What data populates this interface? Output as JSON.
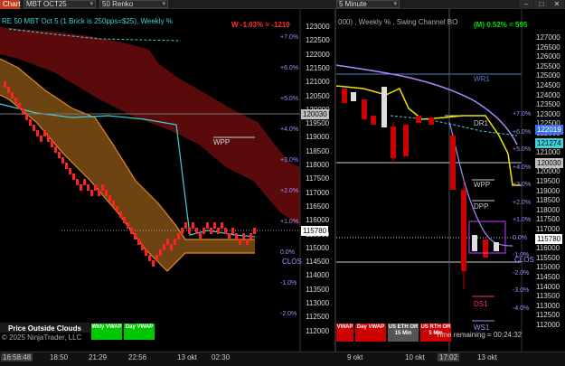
{
  "toolbar": {
    "chart_tab": "Chart",
    "instrument": "MBT OCT25",
    "bar_type": "50 Renko",
    "interval": "5 Minute",
    "win_minimize": "–",
    "win_maximize": "□",
    "win_close": "✕"
  },
  "left": {
    "title": "RE 50 MBT Oct 5 (1 Brick is 250pps=$25), Weekly %",
    "pnl": "W -1.03% = -1210",
    "y_ticks": [
      "123000",
      "122500",
      "122000",
      "121500",
      "121000",
      "120500",
      "120000",
      "119500",
      "119000",
      "118500",
      "118000",
      "117500",
      "117000",
      "116500",
      "116000",
      "115500",
      "115000",
      "114500",
      "114000",
      "113500",
      "113000",
      "112500",
      "112000"
    ],
    "pct_labels": [
      "+7.0%",
      "+6.0%",
      "+5.0%",
      "+4.0%",
      "+3.0%",
      "+2.0%",
      "+1.0%",
      "0.0%",
      "-1.0%",
      "-2.0%"
    ],
    "price_tag_ref": "120030",
    "price_tag_last": "115780",
    "wpp_label": "WPP",
    "clos_label": "CLOS",
    "outside_clouds": "Price Outside Clouds",
    "wkly_vwap": "Wkly VWAP",
    "day_vwap": "Day VWAP",
    "copyright": "© 2025 NinjaTrader, LLC",
    "x_labels": [
      "16:58:48",
      "18:50",
      "21:29",
      "22:56",
      "13 okt",
      "02:30"
    ]
  },
  "right": {
    "title": "000) , Weekly % , Swing Channel BO",
    "pnl": "(M) 0.52% = 595",
    "y_ticks": [
      "127000",
      "126500",
      "126000",
      "125500",
      "125000",
      "124500",
      "124000",
      "123500",
      "123000",
      "122500",
      "122000",
      "121500",
      "121000",
      "120500",
      "120000",
      "119500",
      "119000",
      "118500",
      "118000",
      "117500",
      "117000",
      "116500",
      "116000",
      "115500",
      "115000",
      "114500",
      "114000",
      "113500",
      "113000",
      "112500",
      "112000"
    ],
    "pct_labels": [
      "+7.0%",
      "+6.0%",
      "+5.0%",
      "+4.0%",
      "+3.0%",
      "+2.0%",
      "+1.0%",
      "0.0%",
      "-1.0%",
      "-2.0%",
      "-3.0%",
      "-4.0%"
    ],
    "levels": {
      "wr1": "WR1",
      "dr1": "DR1",
      "wpp": "WPP",
      "dpp": "DPP",
      "clos": "CLOS",
      "ds1": "DS1",
      "ws1": "WS1"
    },
    "price_tag_1": "122019",
    "price_tag_2": "121274",
    "price_tag_3": "120030",
    "price_tag_last": "115780",
    "buttons": [
      "VWAP",
      "Day VWAP",
      "US ETH OR 15 Min",
      "US RTH OR 5 Min"
    ],
    "time_remaining": "Time remaining = 00:24:32",
    "x_labels": [
      "9 okt",
      "10 okt",
      "17:02",
      "13 okt"
    ]
  },
  "colors": {
    "up": "#ff2222",
    "down": "#cc0000",
    "cloud_red": "#5a0a0a",
    "cloud_orange": "#b06a1a",
    "cyan": "#3fd0d8",
    "violet": "#a58bff",
    "yellow": "#f5e400",
    "green": "#00cc00"
  }
}
